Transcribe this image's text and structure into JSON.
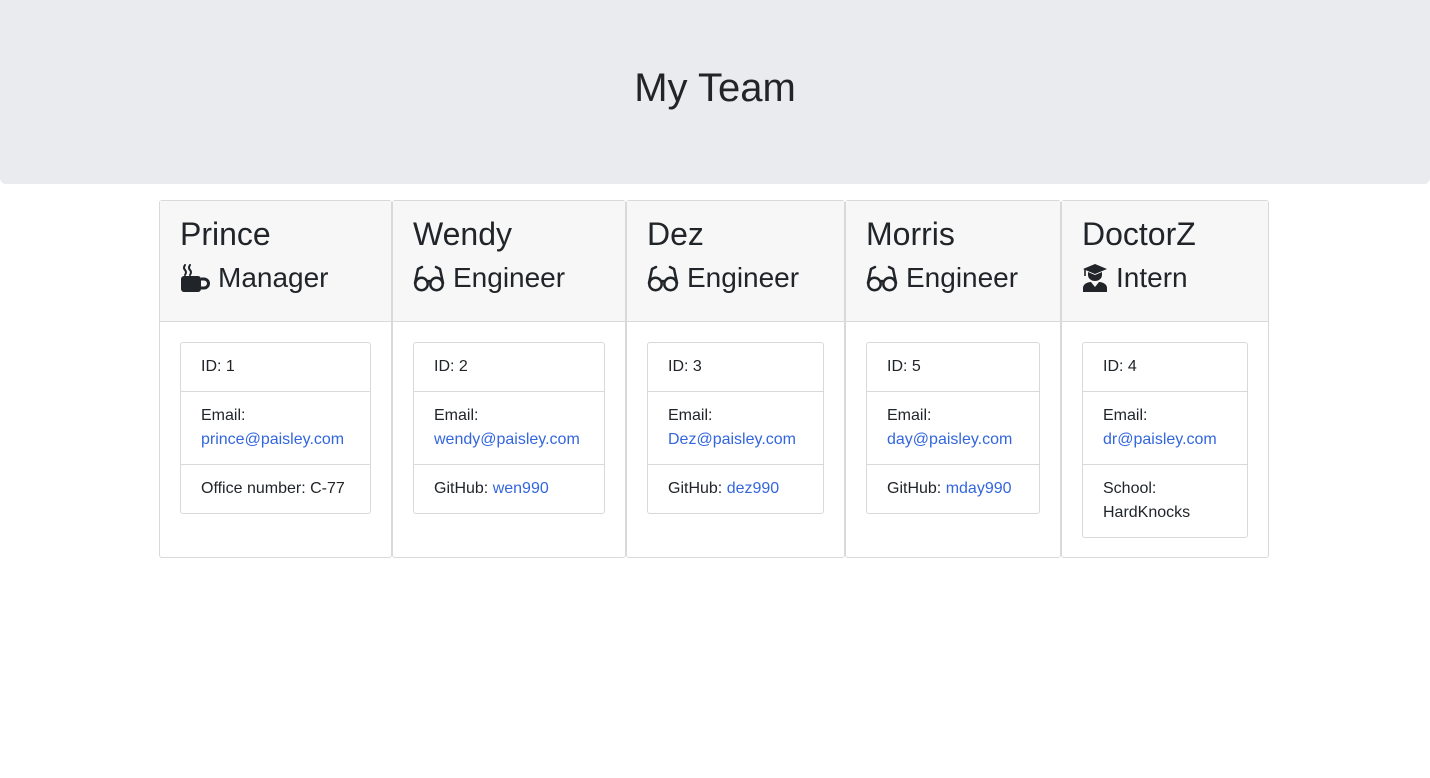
{
  "header": {
    "title": "My Team"
  },
  "colors": {
    "link": "#3366dd",
    "jumbotron": "#e9ebef"
  },
  "cards": [
    {
      "name": "Prince",
      "role": "Manager",
      "role_icon": "mug-icon",
      "id_text": "ID: 1",
      "email_label": "Email:",
      "email": "prince@paisley.com",
      "extra_label": "Office number:",
      "extra_value": "C-77"
    },
    {
      "name": "Wendy",
      "role": "Engineer",
      "role_icon": "glasses-icon",
      "id_text": "ID: 2",
      "email_label": "Email:",
      "email": "wendy@paisley.com",
      "extra_label": "GitHub:",
      "extra_value": "wen990"
    },
    {
      "name": "Dez",
      "role": "Engineer",
      "role_icon": "glasses-icon",
      "id_text": "ID: 3",
      "email_label": "Email:",
      "email": "Dez@paisley.com",
      "extra_label": "GitHub:",
      "extra_value": "dez990"
    },
    {
      "name": "Morris",
      "role": "Engineer",
      "role_icon": "glasses-icon",
      "id_text": "ID: 5",
      "email_label": "Email:",
      "email": "day@paisley.com",
      "extra_label": "GitHub:",
      "extra_value": "mday990"
    },
    {
      "name": "DoctorZ",
      "role": "Intern",
      "role_icon": "graduate-icon",
      "id_text": "ID: 4",
      "email_label": "Email:",
      "email": "dr@paisley.com",
      "extra_label": "School:",
      "extra_value": "HardKnocks"
    }
  ]
}
